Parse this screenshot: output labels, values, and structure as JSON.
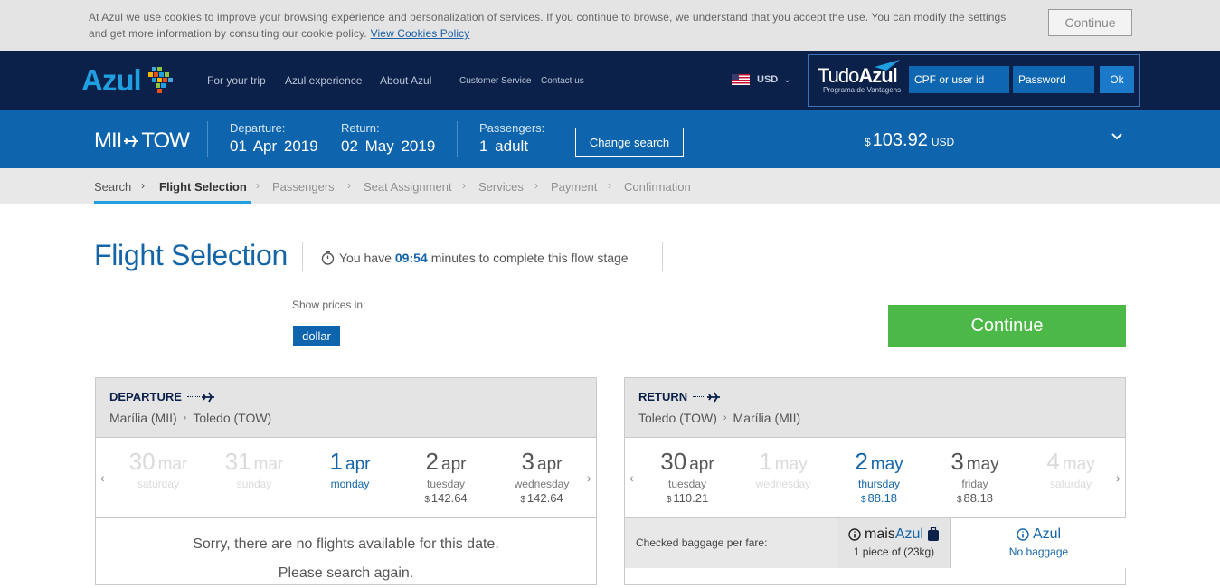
{
  "cookie": {
    "text": "At Azul we use cookies to improve your browsing experience and personalization of services. If you continue to browse, we understand that you accept the use. You can modify the settings and get more information by consulting our cookie policy.",
    "link": "View Cookies Policy",
    "button": "Continue"
  },
  "nav": {
    "logo": "Azul",
    "links": [
      "For your trip",
      "Azul experience",
      "About Azul"
    ],
    "small_links": [
      "Customer Service",
      "Contact us"
    ],
    "currency": "USD",
    "tudo_main_light": "Tudo",
    "tudo_main_bold": "Azul",
    "tudo_sub": "Programa de Vantagens",
    "user_placeholder": "CPF or user id",
    "password_placeholder": "Password",
    "ok": "Ok"
  },
  "summary": {
    "origin": "MII",
    "destination": "TOW",
    "departure_label": "Departure:",
    "departure_value": "01 Apr 2019",
    "return_label": "Return:",
    "return_value": "02 May 2019",
    "passengers_label": "Passengers:",
    "passengers_value": "1 adult",
    "change_button": "Change search",
    "total_currency": "$",
    "total_amount": "103.92",
    "total_code": "USD"
  },
  "steps": [
    "Search",
    "Flight Selection",
    "Passengers",
    "Seat Assignment",
    "Services",
    "Payment",
    "Confirmation"
  ],
  "heading": {
    "title": "Flight Selection",
    "timer_prefix": "You have",
    "timer_value": "09:54",
    "timer_suffix": "minutes to complete this flow stage"
  },
  "prices": {
    "label": "Show prices in:",
    "option": "dollar"
  },
  "continue_button": "Continue",
  "departure": {
    "kind": "DEPARTURE",
    "from": "Marília (MII)",
    "to": "Toledo (TOW)",
    "dates": [
      {
        "day": "30",
        "month": "mar",
        "dow": "saturday",
        "price": "",
        "state": "disabled"
      },
      {
        "day": "31",
        "month": "mar",
        "dow": "sunday",
        "price": "",
        "state": "disabled"
      },
      {
        "day": "1",
        "month": "apr",
        "dow": "monday",
        "price": "",
        "state": "selected"
      },
      {
        "day": "2",
        "month": "apr",
        "dow": "tuesday",
        "price": "142.64",
        "state": "normal"
      },
      {
        "day": "3",
        "month": "apr",
        "dow": "wednesday",
        "price": "142.64",
        "state": "normal"
      }
    ],
    "message_1": "Sorry, there are no flights available for this date.",
    "message_2": "Please search again."
  },
  "return": {
    "kind": "RETURN",
    "from": "Toledo (TOW)",
    "to": "Marília (MII)",
    "dates": [
      {
        "day": "30",
        "month": "apr",
        "dow": "tuesday",
        "price": "110.21",
        "state": "normal"
      },
      {
        "day": "1",
        "month": "may",
        "dow": "wednesday",
        "price": "",
        "state": "disabled"
      },
      {
        "day": "2",
        "month": "may",
        "dow": "thursday",
        "price": "88.18",
        "state": "selected"
      },
      {
        "day": "3",
        "month": "may",
        "dow": "friday",
        "price": "88.18",
        "state": "normal"
      },
      {
        "day": "4",
        "month": "may",
        "dow": "saturday",
        "price": "",
        "state": "disabled"
      }
    ],
    "baggage_label": "Checked baggage per fare:",
    "fare_a_light": "mais",
    "fare_a_bold": "Azul",
    "fare_a_desc": "1 piece of (23kg)",
    "fare_b_name": "Azul",
    "fare_b_desc": "No baggage"
  },
  "price_currency": "$",
  "colors": {
    "navy": "#0b2149",
    "blue": "#0e64ad",
    "accent": "#1f9ee0",
    "green": "#4cb847"
  }
}
